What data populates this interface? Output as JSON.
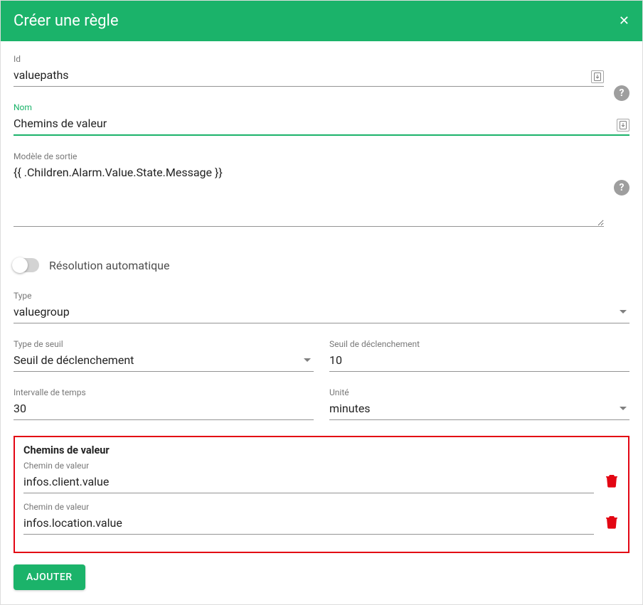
{
  "header": {
    "title": "Créer une règle"
  },
  "fields": {
    "id": {
      "label": "Id",
      "value": "valuepaths"
    },
    "name": {
      "label": "Nom",
      "value": "Chemins de valeur"
    },
    "outputModel": {
      "label": "Modèle de sortie",
      "value": "{{ .Children.Alarm.Value.State.Message }}"
    },
    "autoResolution": {
      "label": "Résolution automatique"
    },
    "type": {
      "label": "Type",
      "value": "valuegroup"
    },
    "thresholdType": {
      "label": "Type de seuil",
      "value": "Seuil de déclenchement"
    },
    "triggerThreshold": {
      "label": "Seuil de déclenchement",
      "value": "10"
    },
    "timeInterval": {
      "label": "Intervalle de temps",
      "value": "30"
    },
    "unit": {
      "label": "Unité",
      "value": "minutes"
    }
  },
  "valuePaths": {
    "panelTitle": "Chemins de valeur",
    "fieldLabel": "Chemin de valeur",
    "items": [
      "infos.client.value",
      "infos.location.value"
    ]
  },
  "buttons": {
    "add": "AJOUTER"
  }
}
